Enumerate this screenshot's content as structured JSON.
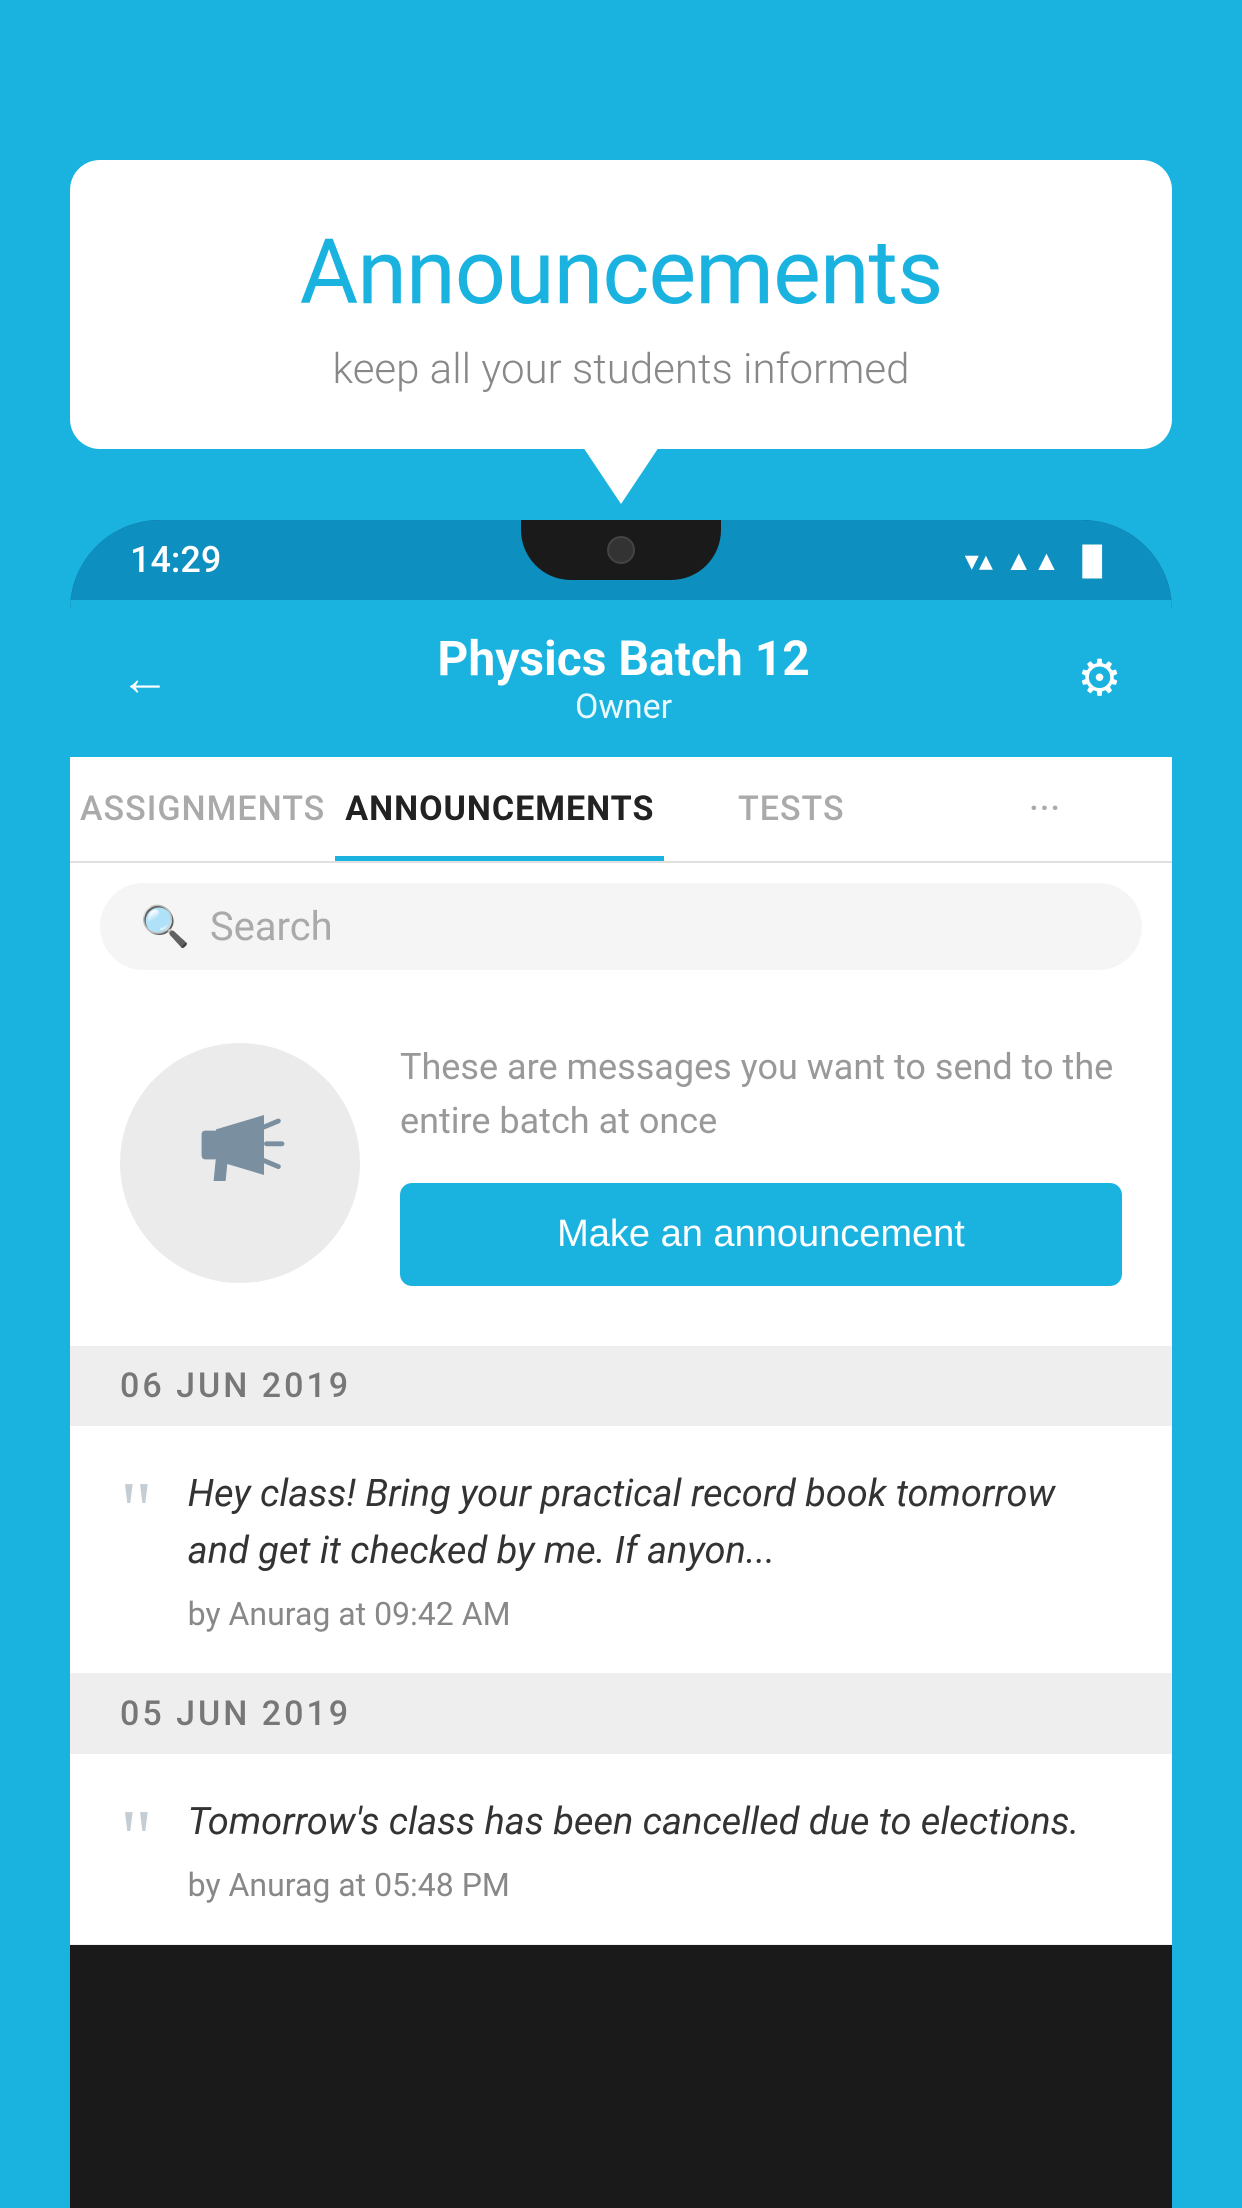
{
  "background_color": "#1ab3e0",
  "speech_bubble": {
    "title": "Announcements",
    "subtitle": "keep all your students informed"
  },
  "status_bar": {
    "time": "14:29",
    "icons": [
      "wifi",
      "signal",
      "battery"
    ]
  },
  "app_header": {
    "title": "Physics Batch 12",
    "subtitle": "Owner",
    "back_label": "←",
    "gear_label": "⚙"
  },
  "tabs": [
    {
      "label": "ASSIGNMENTS",
      "active": false
    },
    {
      "label": "ANNOUNCEMENTS",
      "active": true
    },
    {
      "label": "TESTS",
      "active": false
    },
    {
      "label": "···",
      "active": false
    }
  ],
  "search": {
    "placeholder": "Search"
  },
  "empty_state": {
    "icon": "📣",
    "description": "These are messages you want to send to the entire batch at once",
    "button_label": "Make an announcement"
  },
  "announcements": [
    {
      "date": "06  JUN  2019",
      "text": "Hey class! Bring your practical record book tomorrow and get it checked by me. If anyon...",
      "author": "by Anurag at 09:42 AM"
    },
    {
      "date": "05  JUN  2019",
      "text": "Tomorrow's class has been cancelled due to elections.",
      "author": "by Anurag at 05:48 PM"
    }
  ]
}
